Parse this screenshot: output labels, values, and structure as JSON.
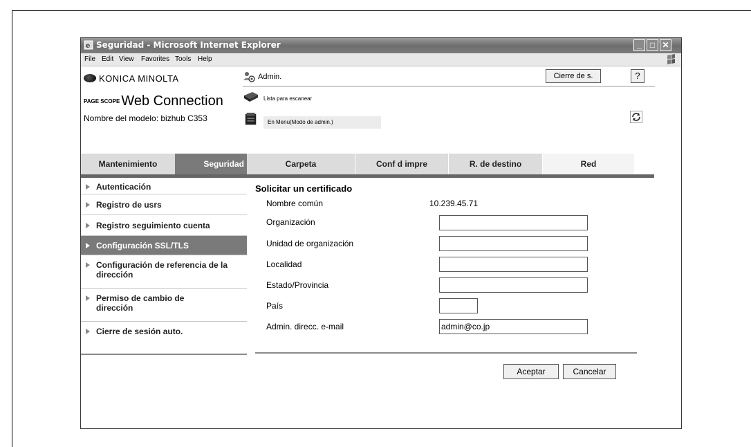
{
  "window": {
    "title": "Seguridad - Microsoft Internet Explorer"
  },
  "menu": {
    "items": [
      "File",
      "Edit",
      "View",
      "Favorites",
      "Tools",
      "Help"
    ]
  },
  "brand": {
    "logo_text": "KONICA MINOLTA",
    "pagescope_small": "PAGE SCOPE",
    "app_name": "Web Connection",
    "model_label": "Nombre del modelo: bizhub C353"
  },
  "header": {
    "user_label": "Admin.",
    "logout_button": "Cierre de s.",
    "help_button": "?",
    "status_scan": "Lista para escanear",
    "status_mode": "En Menu(Modo de admin.)"
  },
  "tabs": [
    {
      "label": "Mantenimiento"
    },
    {
      "label": "Seguridad"
    },
    {
      "label": "Carpeta"
    },
    {
      "label": "Conf d impre"
    },
    {
      "label": "R. de destino"
    },
    {
      "label": "Red"
    }
  ],
  "sidebar": {
    "items": [
      {
        "label": "Autenticación"
      },
      {
        "label": "Registro de usrs"
      },
      {
        "label": "Registro seguimiento cuenta"
      },
      {
        "label": "Configuración SSL/TLS"
      },
      {
        "label": "Configuración de referencia de la dirección"
      },
      {
        "label": "Permiso de cambio de dirección"
      },
      {
        "label": "Cierre de sesión auto."
      }
    ]
  },
  "form": {
    "title": "Solicitar un certificado",
    "common_name_label": "Nombre común",
    "common_name_value": "10.239.45.71",
    "fields": [
      {
        "label": "Organización",
        "value": ""
      },
      {
        "label": "Unidad de organización",
        "value": ""
      },
      {
        "label": "Localidad",
        "value": ""
      },
      {
        "label": "Estado/Provincia",
        "value": ""
      },
      {
        "label": "País",
        "value": ""
      },
      {
        "label": "Admin. direcc. e-mail",
        "value": "admin@co.jp"
      }
    ],
    "ok_button": "Aceptar",
    "cancel_button": "Cancelar"
  }
}
